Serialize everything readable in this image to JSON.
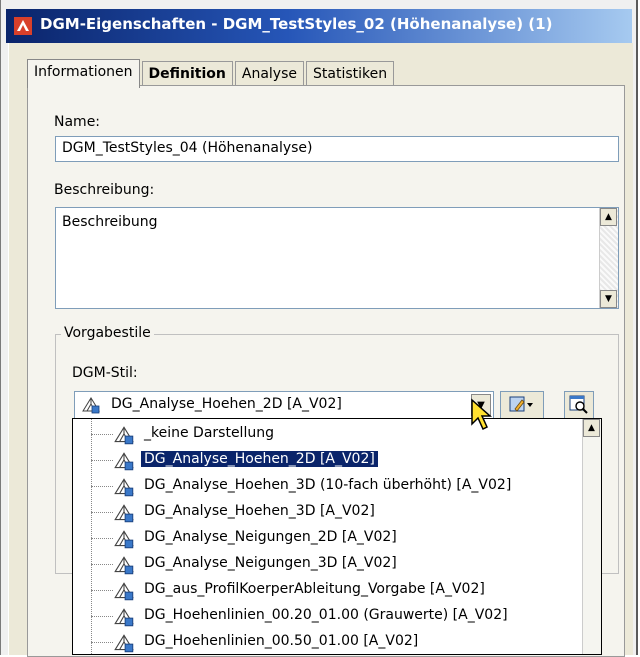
{
  "window": {
    "title": "DGM-Eigenschaften - DGM_TestStyles_02 (Höhenanalyse) (1)"
  },
  "tabs": [
    {
      "label": "Informationen",
      "active": true
    },
    {
      "label": "Definition",
      "active": false
    },
    {
      "label": "Analyse",
      "active": false
    },
    {
      "label": "Statistiken",
      "active": false
    }
  ],
  "form": {
    "name_label": "Name:",
    "name_value": "DGM_TestStyles_04 (Höhenanalyse)",
    "description_label": "Beschreibung:",
    "description_value": "Beschreibung",
    "group_label": "Vorgabestile",
    "style_label": "DGM-Stil:",
    "style_value": "DG_Analyse_Hoehen_2D [A_V02]"
  },
  "dropdown": {
    "items": [
      "_keine Darstellung",
      "DG_Analyse_Hoehen_2D [A_V02]",
      "DG_Analyse_Hoehen_3D (10-fach überhöht) [A_V02]",
      "DG_Analyse_Hoehen_3D [A_V02]",
      "DG_Analyse_Neigungen_2D [A_V02]",
      "DG_Analyse_Neigungen_3D [A_V02]",
      "DG_aus_ProfilKoerperAbleitung_Vorgabe [A_V02]",
      "DG_Hoehenlinien_00.20_01.00 (Grauwerte) [A_V02]",
      "DG_Hoehenlinien_00.50_01.00 [A_V02]"
    ],
    "selected_index": 1
  },
  "colors": {
    "title_start": "#0a246a",
    "title_end": "#a6caf0",
    "selection": "#0a246a"
  }
}
